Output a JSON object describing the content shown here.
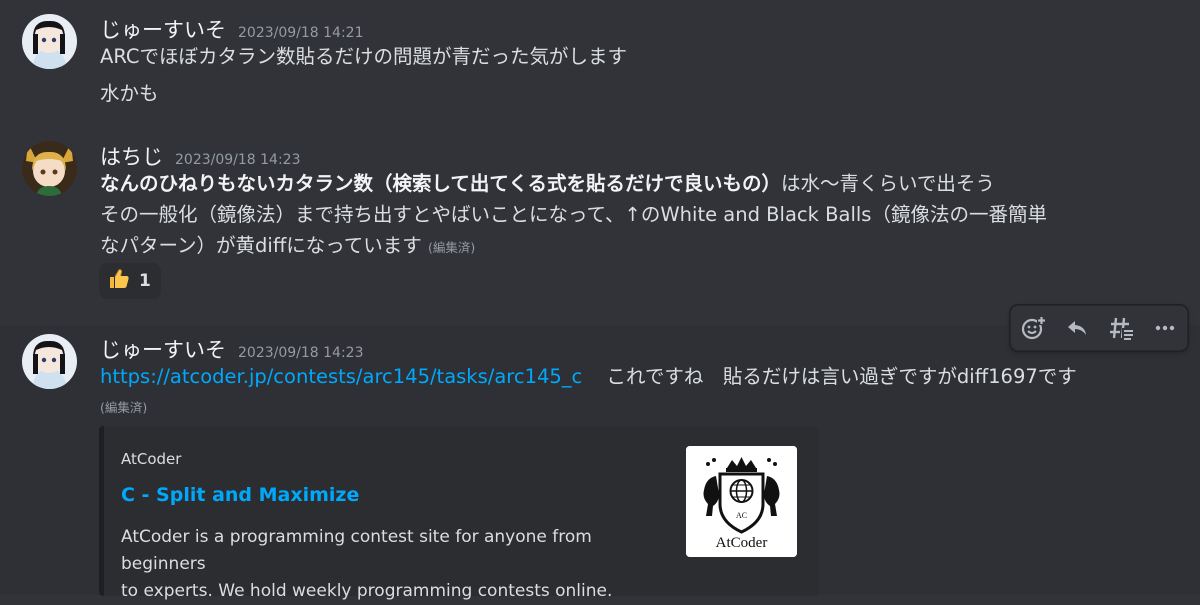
{
  "messages": [
    {
      "author": "じゅーすいそ",
      "timestamp": "2023/09/18 14:21",
      "lines": [
        "ARCでほぼカタラン数貼るだけの問題が青だった気がします",
        "水かも"
      ]
    },
    {
      "author": "はちじ",
      "timestamp": "2023/09/18 14:23",
      "line1_bold": "なんのひねりもないカタラン数（検索して出てくる式を貼るだけで良いもの）",
      "line1_rest": "は水〜青くらいで出そう",
      "line2": "その一般化（鏡像法）まで持ち出すとやばいことになって、↑のWhite and Black Balls（鏡像法の一番簡単",
      "line3": "なパターン）が黄diffになっています",
      "edited": "(編集済)",
      "reaction": {
        "emoji": "thumbs-up",
        "count": "1"
      }
    },
    {
      "author": "じゅーすいそ",
      "timestamp": "2023/09/18 14:23",
      "link": "https://atcoder.jp/contests/arc145/tasks/arc145_c",
      "text": "これですね　貼るだけは言い過ぎですがdiff1697です",
      "edited": "(編集済)",
      "embed": {
        "provider": "AtCoder",
        "title": "C - Split and Maximize",
        "description_line1": "AtCoder is a programming contest site for anyone from beginners",
        "description_line2": "to experts. We hold weekly programming contests online.",
        "thumbnail_text": "AtCoder"
      }
    }
  ],
  "toolbar": {
    "icons": [
      "add-reaction-icon",
      "reply-icon",
      "create-thread-icon",
      "more-icon"
    ]
  },
  "colors": {
    "background": "#313338",
    "link": "#00a8fc",
    "text": "#dbdee1",
    "timestamp": "#949ba4"
  }
}
